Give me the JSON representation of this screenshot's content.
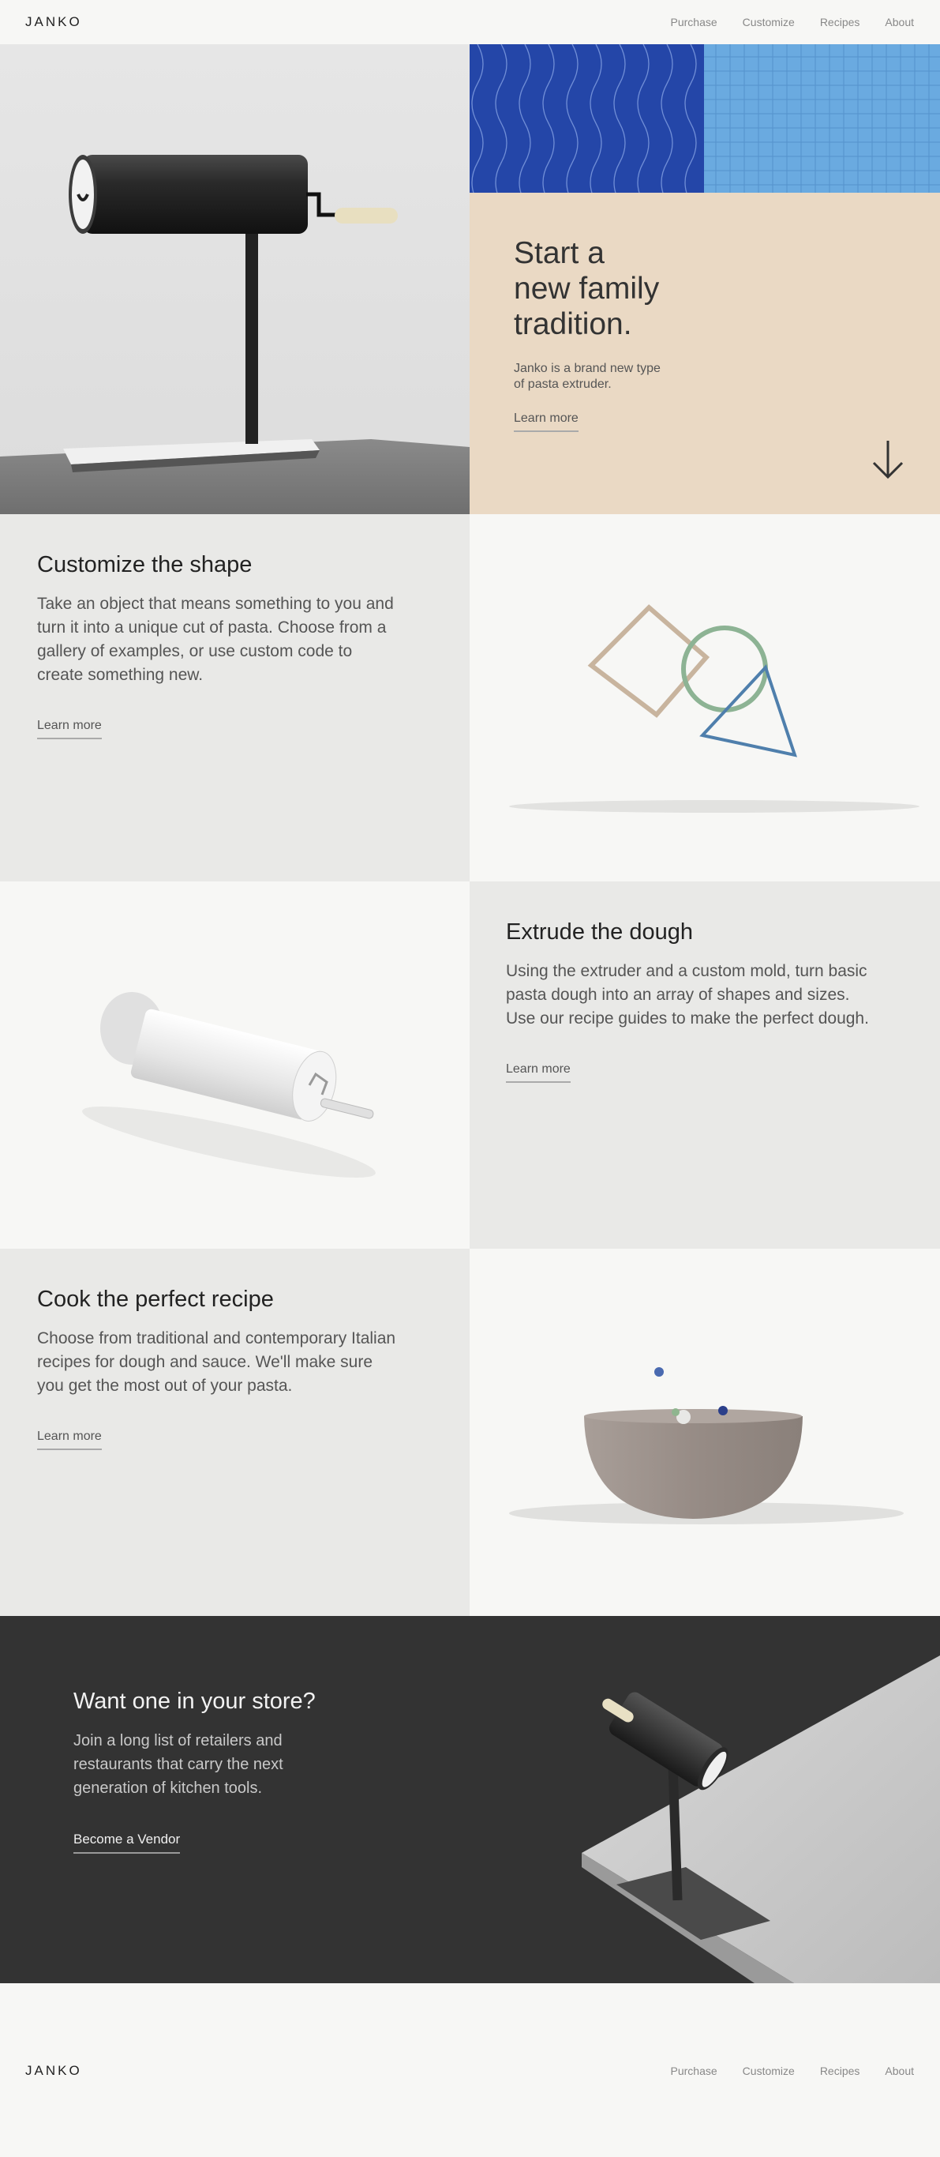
{
  "brand": "JANKO",
  "nav": [
    {
      "label": "Purchase"
    },
    {
      "label": "Customize"
    },
    {
      "label": "Recipes"
    },
    {
      "label": "About"
    }
  ],
  "hero": {
    "title_lines": [
      "Start a",
      "new family",
      "tradition."
    ],
    "subtitle_lines": [
      "Janko is a brand new type",
      "of pasta extruder."
    ],
    "cta": "Learn more",
    "colors": {
      "beige": "#ead9c4",
      "pattern_blue": "#2446a8",
      "grid_blue": "#6aaae0"
    }
  },
  "sections": [
    {
      "title": "Customize the shape",
      "body": "Take an object that means something to you and turn it into a unique cut of pasta. Choose from a gallery of examples, or use custom code to create something new.",
      "cta": "Learn more"
    },
    {
      "title": "Extrude the dough",
      "body": "Using the extruder and a custom mold, turn basic pasta dough into an array of shapes and sizes. Use our recipe guides to make the perfect dough.",
      "cta": "Learn more"
    },
    {
      "title": "Cook the perfect recipe",
      "body": "Choose from traditional and contemporary Italian recipes for dough and sauce. We'll make sure you get the most out of your pasta.",
      "cta": "Learn more"
    }
  ],
  "vendor": {
    "title": "Want one in your store?",
    "body": "Join a long list of retailers and restaurants that carry the next generation of kitchen tools.",
    "cta": "Become a Vendor",
    "bg": "#333333"
  },
  "footer": {
    "brand": "JANKO",
    "nav": [
      {
        "label": "Purchase"
      },
      {
        "label": "Customize"
      },
      {
        "label": "Recipes"
      },
      {
        "label": "About"
      }
    ]
  }
}
